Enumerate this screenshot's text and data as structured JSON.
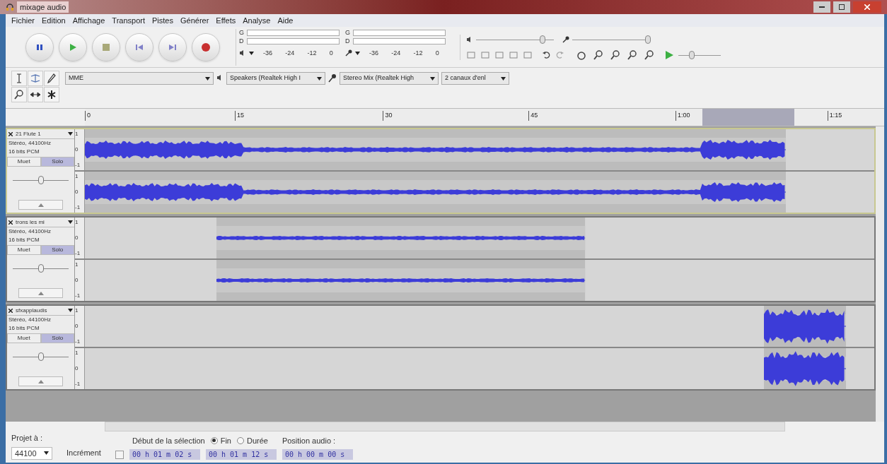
{
  "window": {
    "title": "mixage audio"
  },
  "menu": [
    "Fichier",
    "Edition",
    "Affichage",
    "Transport",
    "Pistes",
    "Générer",
    "Effets",
    "Analyse",
    "Aide"
  ],
  "meters": [
    {
      "kind": "playback",
      "channels": [
        "G",
        "D"
      ],
      "ticks": [
        "-36",
        "-24",
        "-12",
        "0"
      ]
    },
    {
      "kind": "recording",
      "channels": [
        "G",
        "D"
      ],
      "ticks": [
        "-36",
        "-24",
        "-12",
        "0"
      ]
    }
  ],
  "mixer": [
    {
      "kind": "playback",
      "level": 0.85
    },
    {
      "kind": "recording",
      "level": 0.97
    }
  ],
  "play_at_speed": {
    "level": 0.32
  },
  "devices": {
    "host": "MME",
    "output": "Speakers (Realtek High I",
    "input": "Stereo Mix (Realtek High",
    "channels": "2 canaux d'enl"
  },
  "ruler": {
    "labels": [
      "0",
      "15",
      "30",
      "45",
      "1:00",
      "1:15"
    ]
  },
  "tracks": [
    {
      "name": "21 Flute 1",
      "info": [
        "Stéréo, 44100Hz",
        "16 bits PCM"
      ],
      "mute": "Muet",
      "solo": "Solo",
      "gain": {
        "level": 0.5
      },
      "channels": [
        {
          "scale": [
            "1",
            "0",
            "-1"
          ]
        },
        {
          "scale": [
            "1",
            "0",
            "-1"
          ]
        }
      ]
    },
    {
      "name": "trons les mi",
      "info": [
        "Stéréo, 44100Hz",
        "16 bits PCM"
      ],
      "mute": "Muet",
      "solo": "Solo",
      "gain": {
        "level": 0.5
      },
      "channels": [
        {
          "scale": [
            "1",
            "0",
            "-1"
          ]
        },
        {
          "scale": [
            "1",
            "0",
            "-1"
          ]
        }
      ]
    },
    {
      "name": "sfxapplaudis",
      "info": [
        "Stéréo, 44100Hz",
        "16 bits PCM"
      ],
      "mute": "Muet",
      "solo": "Solo",
      "gain": {
        "level": 0.5
      },
      "channels": [
        {
          "scale": [
            "1",
            "0",
            "-1"
          ]
        },
        {
          "scale": [
            "1",
            "0",
            "-1"
          ]
        }
      ]
    }
  ],
  "bottom": {
    "project_rate_label": "Projet à :",
    "project_rate": "44100",
    "snap_label": "Incrément",
    "snap_checked": false,
    "selection_label": "Début de la sélection",
    "radios": [
      {
        "label": "Fin",
        "selected": true
      },
      {
        "label": "Durée",
        "selected": false
      }
    ],
    "position_label": "Position audio :",
    "times": [
      "00 h 01 m 02 s",
      "00 h 01 m 12 s",
      "00 h 00 m 00 s"
    ]
  }
}
